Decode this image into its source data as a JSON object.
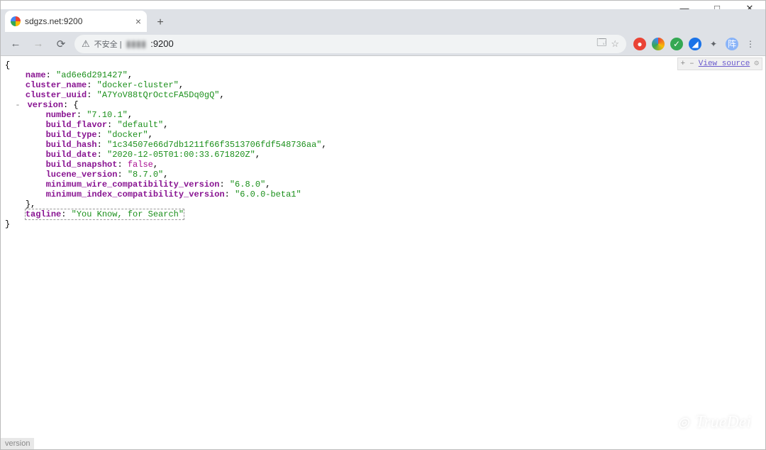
{
  "browser": {
    "tab_title": "sdgzs.net:9200",
    "newtab_tooltip": "+",
    "address_security": "不安全 |",
    "url_display": ":9200",
    "translate_icon": "translate-icon",
    "win_minimize": "—",
    "win_maximize": "□",
    "win_close": "✕"
  },
  "extensions": {
    "star": "★",
    "menu": "⋮",
    "puzzle": "✦"
  },
  "json_bar": {
    "plus": "+",
    "minus": "–",
    "view_source": "View source",
    "gear": "⚙"
  },
  "json": {
    "name_key": "name",
    "name_val": "\"ad6e6d291427\"",
    "cluster_name_key": "cluster_name",
    "cluster_name_val": "\"docker-cluster\"",
    "cluster_uuid_key": "cluster_uuid",
    "cluster_uuid_val": "\"A7YoV88tQrOctcFA5Dq0gQ\"",
    "version_key": "version",
    "number_key": "number",
    "number_val": "\"7.10.1\"",
    "build_flavor_key": "build_flavor",
    "build_flavor_val": "\"default\"",
    "build_type_key": "build_type",
    "build_type_val": "\"docker\"",
    "build_hash_key": "build_hash",
    "build_hash_val": "\"1c34507e66d7db1211f66f3513706fdf548736aa\"",
    "build_date_key": "build_date",
    "build_date_val": "\"2020-12-05T01:00:33.671820Z\"",
    "build_snapshot_key": "build_snapshot",
    "build_snapshot_val": "false",
    "lucene_version_key": "lucene_version",
    "lucene_version_val": "\"8.7.0\"",
    "min_wire_key": "minimum_wire_compatibility_version",
    "min_wire_val": "\"6.8.0\"",
    "min_index_key": "minimum_index_compatibility_version",
    "min_index_val": "\"6.0.0-beta1\"",
    "tagline_key": "tagline",
    "tagline_val": "\"You Know, for Search\""
  },
  "status": "version",
  "watermark": "TrueDei"
}
